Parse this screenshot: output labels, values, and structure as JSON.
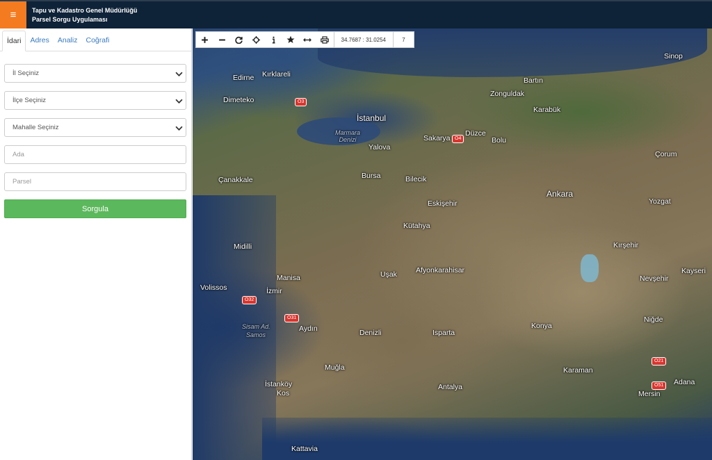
{
  "header": {
    "menu_icon": "≡",
    "title_line1": "Tapu ve Kadastro Genel Müdürlüğü",
    "title_line2": "Parsel Sorgu Uygulaması"
  },
  "tabs": [
    "İdari",
    "Adres",
    "Analiz",
    "Coğrafi"
  ],
  "form": {
    "il": "İl Seçiniz",
    "ilce": "İlçe Seçiniz",
    "mahalle": "Mahalle Seçiniz",
    "ada_placeholder": "Ada",
    "parsel_placeholder": "Parsel",
    "submit": "Sorgula"
  },
  "toolbar": {
    "coordinates": "34.7687 : 31.0254",
    "zoom": "7"
  },
  "map_labels": {
    "sinop": "Sinop",
    "bartin": "Bartın",
    "zonguldak": "Zonguldak",
    "karabuk": "Karabük",
    "edirne": "Edirne",
    "kirklareli": "Kırklareli",
    "istanbul": "İstanbul",
    "dimeteko": "Dimeteko",
    "marmara": "Marmara Denizi",
    "yalova": "Yalova",
    "sakarya": "Sakarya",
    "duzce": "Düzce",
    "bolu": "Bolu",
    "corum": "Çorum",
    "canakkale": "Çanakkale",
    "bursa": "Bursa",
    "bilecik": "Bilecik",
    "ankara": "Ankara",
    "eskisehir": "Eskişehir",
    "yozgat": "Yozgat",
    "kutahya": "Kütahya",
    "midilli": "Midilli",
    "kirsehir": "Kırşehir",
    "manisa": "Manisa",
    "usak": "Uşak",
    "afyon": "Afyonkarahisar",
    "kayseri": "Kayseri",
    "nevsehir": "Nevşehir",
    "volissos": "Volissos",
    "izmir": "İzmir",
    "aydin": "Aydın",
    "denizli": "Denizli",
    "isparta": "Isparta",
    "konya": "Konya",
    "nigde": "Niğde",
    "mugla": "Muğla",
    "karaman": "Karaman",
    "istankoy": "İstanköy",
    "kos": "Kos",
    "antalya": "Antalya",
    "adana": "Adana",
    "mersin": "Mersin",
    "kattavia": "Kattavia",
    "samos": "Sisam Ad.",
    "samos2": "Samos",
    "o3": "O3",
    "o4": "O4",
    "o32": "O32",
    "o31": "O31",
    "o21": "O21",
    "o51": "O51"
  }
}
